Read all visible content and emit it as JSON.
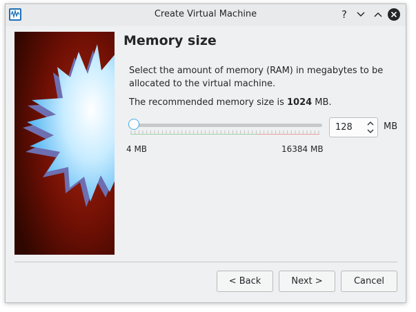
{
  "window": {
    "title": "Create Virtual Machine",
    "help_glyph": "?"
  },
  "page": {
    "heading": "Memory size",
    "description": "Select the amount of memory (RAM) in megabytes to be allocated to the virtual machine.",
    "recommend_prefix": "The recommended memory size is ",
    "recommend_value": "1024",
    "recommend_suffix": " MB."
  },
  "memory": {
    "value": "128",
    "unit": "MB",
    "min_label": "4 MB",
    "max_label": "16384 MB",
    "min_mb": 4,
    "max_mb": 16384,
    "current_mb": 128
  },
  "buttons": {
    "back": "< Back",
    "next": "Next >",
    "cancel": "Cancel"
  },
  "colors": {
    "accent": "#3daee9",
    "tick_green": "#9fd4a2",
    "tick_red": "#e9a3a0",
    "image_bg": "#6e0f04"
  },
  "icons": {
    "app": "virtualbox-icon",
    "help": "help-icon",
    "minimize": "chevron-down-icon",
    "maximize": "chevron-up-icon",
    "close": "close-icon"
  }
}
